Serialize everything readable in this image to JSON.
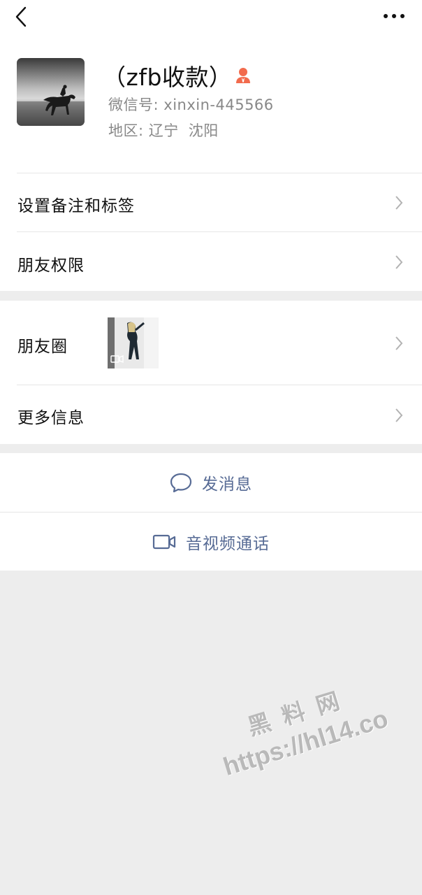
{
  "profile": {
    "name": "（zfb收款）",
    "wxid_label": "微信号:",
    "wxid_value": "xinxin-445566",
    "region_label": "地区:",
    "region_province": "辽宁",
    "region_city": "沈阳"
  },
  "menu": {
    "remark_label": "设置备注和标签",
    "permissions_label": "朋友权限",
    "moments_label": "朋友圈",
    "more_info_label": "更多信息"
  },
  "actions": {
    "message_label": "发消息",
    "call_label": "音视频通话"
  },
  "watermark": {
    "line1": "黑料网",
    "line2": "https://hl14.co"
  },
  "colors": {
    "link": "#576b95",
    "badge": "#f26b4d",
    "background": "#ededed"
  },
  "icons": [
    "back-arrow-icon",
    "more-dots-icon",
    "verified-person-icon",
    "chevron-right-icon",
    "video-indicator-icon",
    "chat-bubble-icon",
    "video-camera-icon"
  ]
}
